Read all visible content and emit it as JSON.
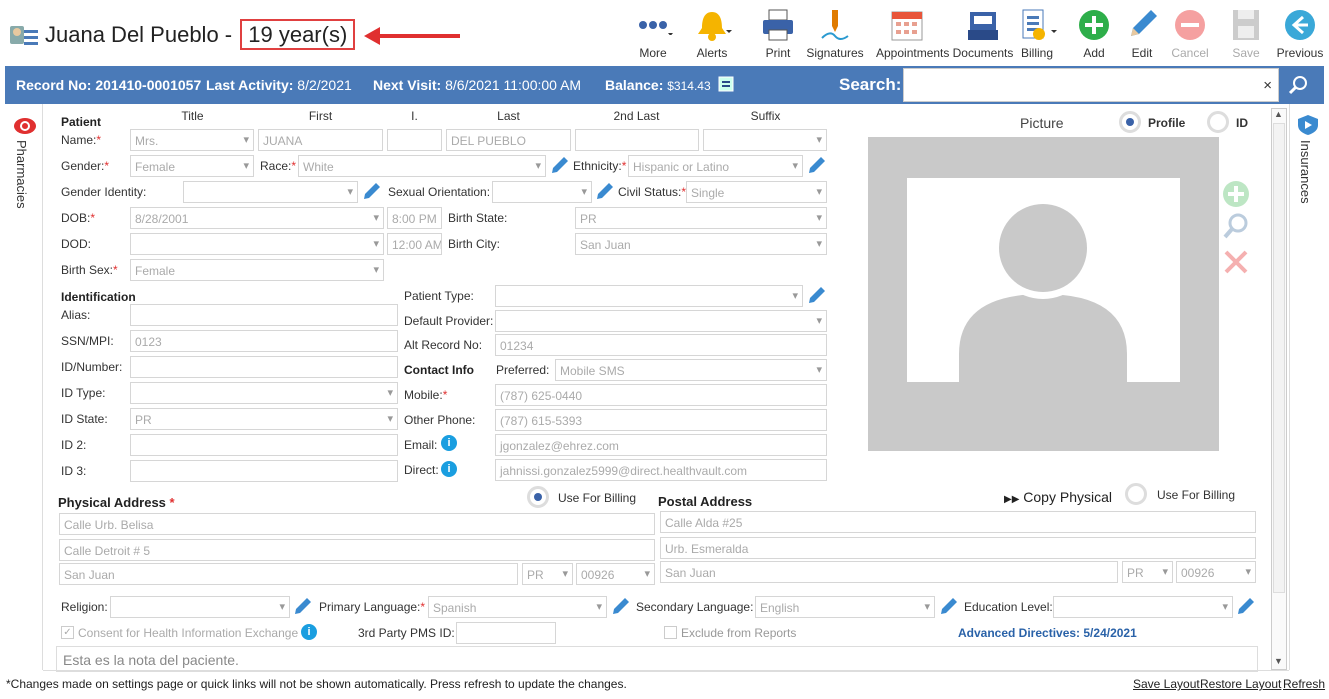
{
  "header": {
    "name": "Juana Del Pueblo -",
    "age": "19 year(s)"
  },
  "toolbar": [
    {
      "label": "More",
      "icon": "more-icon"
    },
    {
      "label": "Alerts",
      "icon": "bell-icon"
    },
    {
      "label": "Print",
      "icon": "printer-icon"
    },
    {
      "label": "Signatures",
      "icon": "signature-icon"
    },
    {
      "label": "Appointments",
      "icon": "calendar-icon"
    },
    {
      "label": "Documents",
      "icon": "documents-icon"
    },
    {
      "label": "Billing",
      "icon": "billing-icon"
    },
    {
      "label": "Add",
      "icon": "add-icon"
    },
    {
      "label": "Edit",
      "icon": "pencil-icon"
    },
    {
      "label": "Cancel",
      "icon": "cancel-icon"
    },
    {
      "label": "Save",
      "icon": "save-icon"
    },
    {
      "label": "Previous",
      "icon": "back-icon"
    }
  ],
  "bar": {
    "record_label": "Record No:",
    "record_value": "201410-0001057",
    "activity_label": "Last Activity:",
    "activity_value": "8/2/2021",
    "visit_label": "Next Visit:",
    "visit_value": "8/6/2021 11:00:00 AM",
    "balance_label": "Balance:",
    "balance_value": "$314.43",
    "search_label": "Search:",
    "clear": "×"
  },
  "side": {
    "left": "Pharmacies",
    "right": "Insurances"
  },
  "patient": {
    "section": "Patient",
    "cols": [
      "Title",
      "First",
      "I.",
      "Last",
      "2nd Last",
      "Suffix"
    ],
    "name_label": "Name:",
    "title": "Mrs.",
    "first": "JUANA",
    "last": "DEL PUEBLO",
    "gender_label": "Gender:",
    "gender": "Female",
    "race_label": "Race:",
    "race": "White",
    "ethnicity_label": "Ethnicity:",
    "ethnicity": "Hispanic or Latino",
    "gid_label": "Gender Identity:",
    "so_label": "Sexual Orientation:",
    "cs_label": "Civil Status:",
    "cs": "Single",
    "dob_label": "DOB:",
    "dob": "8/28/2001",
    "dob_time": "8:00 PM",
    "bstate_label": "Birth State:",
    "bstate": "PR",
    "dod_label": "DOD:",
    "dod_time": "12:00 AM",
    "bcity_label": "Birth City:",
    "bcity": "San Juan",
    "bsex_label": "Birth Sex:",
    "bsex": "Female"
  },
  "ident": {
    "section": "Identification",
    "alias": "Alias:",
    "ssn": "SSN/MPI:",
    "ssn_v": "0123",
    "idn": "ID/Number:",
    "idt": "ID Type:",
    "ids": "ID State:",
    "ids_v": "PR",
    "id2": "ID 2:",
    "id3": "ID 3:"
  },
  "misc": {
    "ptype": "Patient Type:",
    "dprov": "Default Provider:",
    "alt": "Alt Record No:",
    "alt_v": "01234",
    "contact": "Contact Info",
    "pref": "Preferred:",
    "pref_v": "Mobile SMS",
    "mobile": "Mobile:",
    "mobile_v": "(787) 625-0440",
    "other": "Other Phone:",
    "other_v": "(787) 615-5393",
    "email": "Email:",
    "email_v": "jgonzalez@ehrez.com",
    "direct": "Direct:",
    "direct_v": "jahnissi.gonzalez5999@direct.healthvault.com"
  },
  "picture": {
    "title": "Picture",
    "profile": "Profile",
    "id": "ID"
  },
  "phys": {
    "title": "Physical Address",
    "use": "Use For Billing",
    "l1": "Calle Urb. Belisa",
    "l2": "Calle Detroit # 5",
    "city": "San Juan",
    "st": "PR",
    "zip": "00926"
  },
  "post": {
    "title": "Postal Address",
    "copy": "Copy Physical",
    "use": "Use For Billing",
    "l1": "Calle Alda #25",
    "l2": "Urb. Esmeralda",
    "city": "San Juan",
    "st": "PR",
    "zip": "00926"
  },
  "bottom": {
    "religion": "Religion:",
    "plang": "Primary Language:",
    "plang_v": "Spanish",
    "slang": "Secondary Language:",
    "slang_v": "English",
    "edu": "Education Level:",
    "consent": "Consent for Health Information Exchange",
    "third": "3rd Party PMS ID:",
    "exclude": "Exclude from Reports",
    "adv": "Advanced Directives: 5/24/2021",
    "note": "Esta es la nota del paciente."
  },
  "footer": {
    "note": "*Changes made on settings page or quick links will not be shown automatically. Press refresh to update the changes.",
    "save": "Save Layout",
    "restore": "Restore Layout",
    "refresh": "Refresh"
  }
}
